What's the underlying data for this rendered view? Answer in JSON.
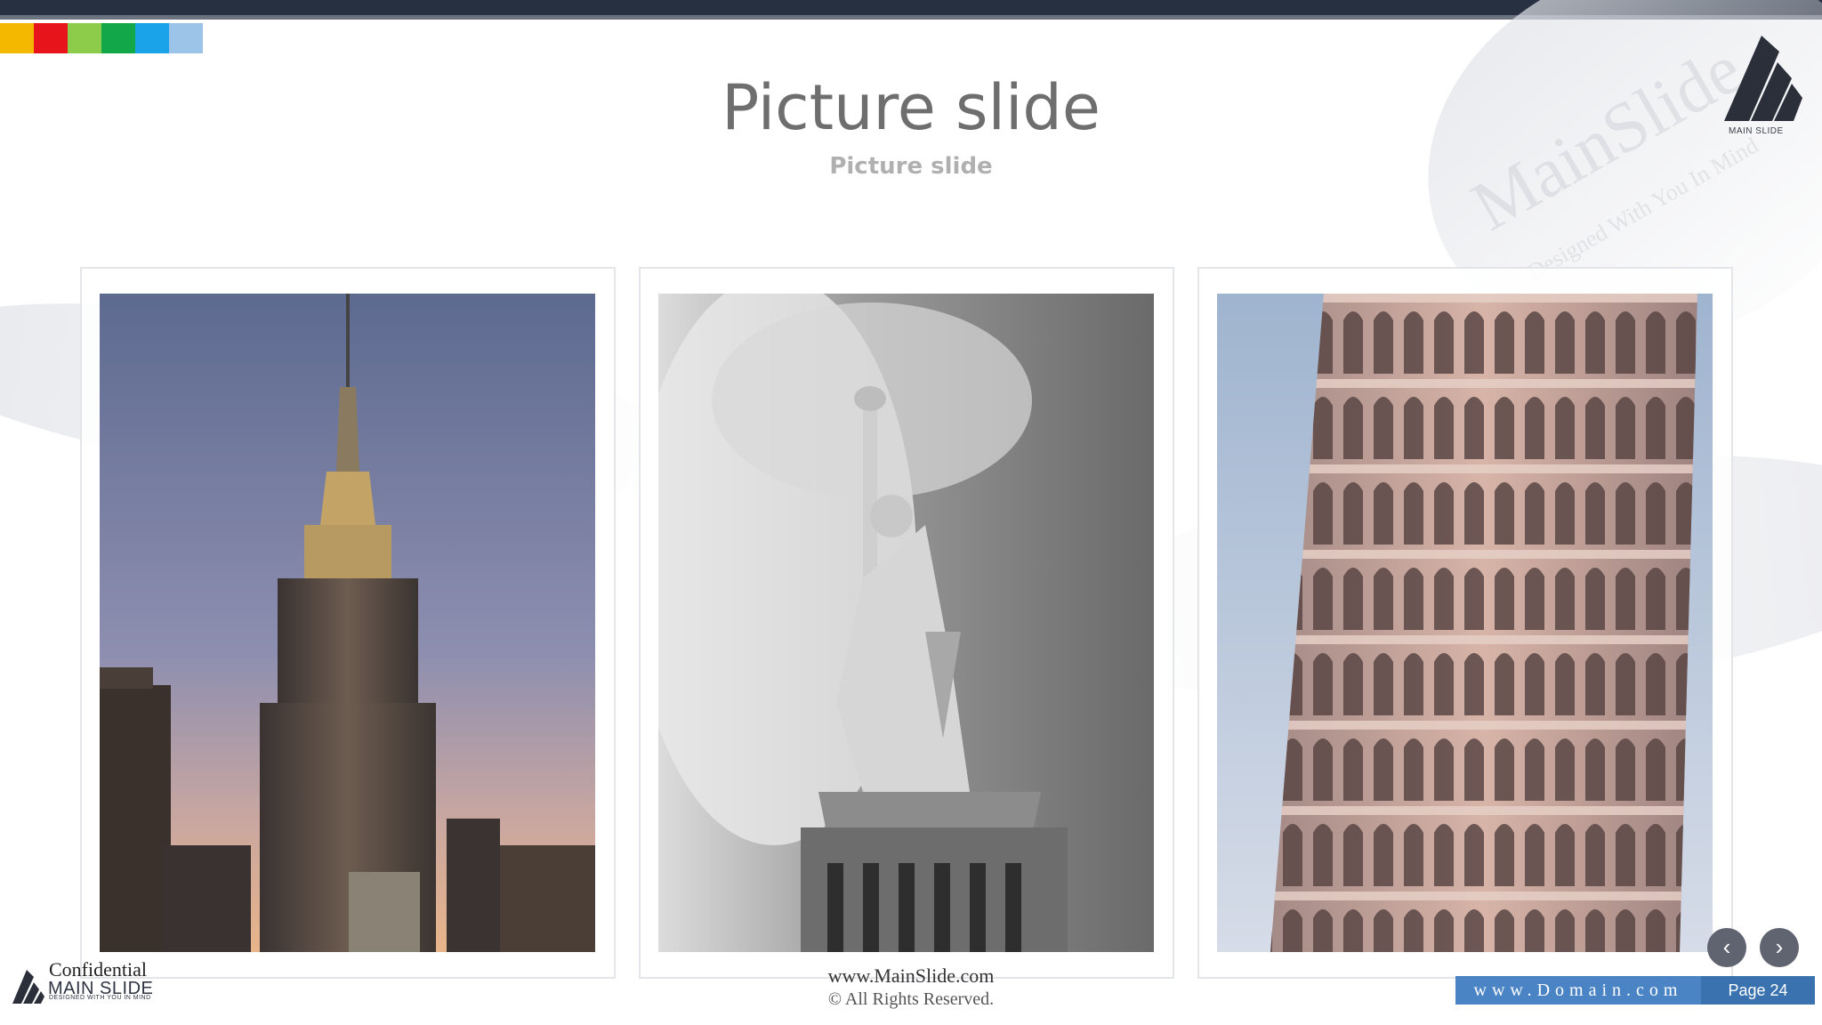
{
  "colors": {
    "stripes": [
      "#f5b800",
      "#e8141c",
      "#8dcb4b",
      "#12a84a",
      "#1aa3e8",
      "#9cc4e8"
    ],
    "title": "#6e6e6e",
    "subtitle": "#b0b0b0",
    "domain_bar": "#4a84c4",
    "page_bar": "#3a72b0",
    "dark_bar": "#263040"
  },
  "slide": {
    "title": "Picture slide",
    "subtitle": "Picture slide"
  },
  "watermark": {
    "brand": "MainSlide",
    "tagline": "Designed With You In Mind"
  },
  "brand_logo": {
    "label": "MAIN SLIDE"
  },
  "pictures": [
    {
      "subject": "Empire State Building at dusk",
      "icon": "skyscraper-photo"
    },
    {
      "subject": "Statue of Liberty in black and white",
      "icon": "statue-photo"
    },
    {
      "subject": "Leaning Tower of Pisa",
      "icon": "tower-photo"
    }
  ],
  "footer": {
    "website": "www.MainSlide.com",
    "rights": "© All Rights Reserved.",
    "confidential": "Confidential",
    "brand": "MAIN SLIDE",
    "brand_tagline": "DESIGNED WITH YOU IN MIND",
    "domain": "www.Domain.com",
    "page": "Page 24"
  },
  "nav": {
    "prev": "‹",
    "next": "›"
  }
}
